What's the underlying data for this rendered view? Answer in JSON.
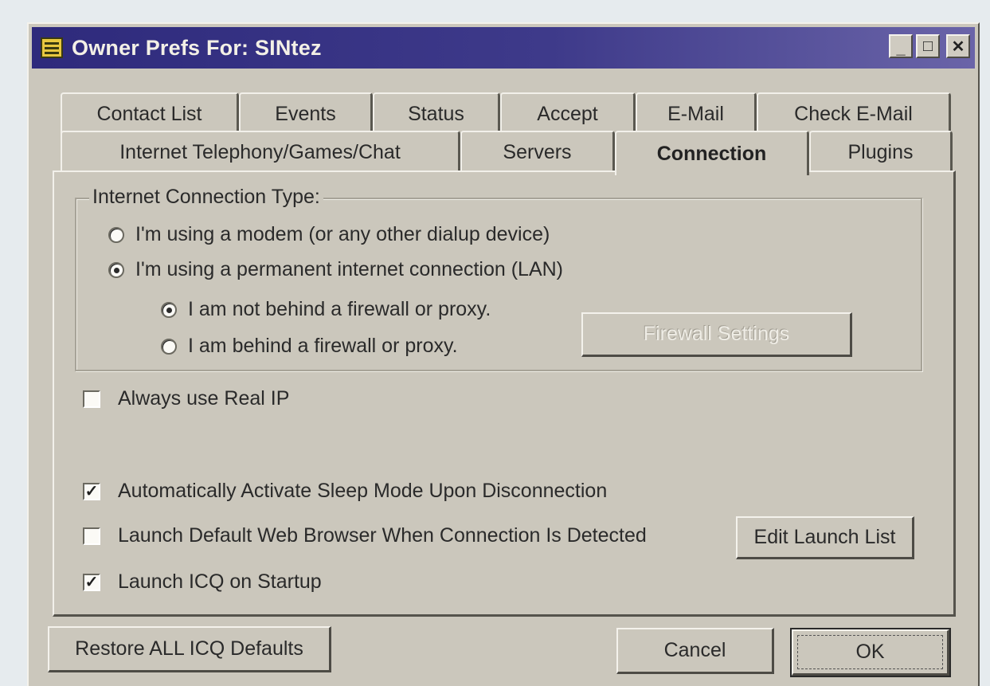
{
  "window": {
    "title": "Owner Prefs For: SINtez",
    "minimize_glyph": "_",
    "maximize_glyph": "□",
    "close_glyph": "✕"
  },
  "tabs_row1": [
    "Contact List",
    "Events",
    "Status",
    "Accept",
    "E-Mail",
    "Check E-Mail"
  ],
  "tabs_row2": [
    "Internet Telephony/Games/Chat",
    "Servers",
    "Connection",
    "Plugins"
  ],
  "active_tab": "Connection",
  "connection": {
    "group_label": "Internet Connection Type:",
    "radio_modem": "I'm using a modem (or any other dialup device)",
    "radio_lan": "I'm using a permanent internet connection (LAN)",
    "radio_no_firewall": "I am not behind a firewall or proxy.",
    "radio_firewall": "I am behind a firewall or proxy.",
    "firewall_settings_button": "Firewall Settings",
    "selected_type": "lan",
    "selected_firewall": "not_behind"
  },
  "options": {
    "real_ip": {
      "label": "Always use Real IP",
      "checked": false
    },
    "sleep_mode": {
      "label": "Automatically Activate Sleep Mode Upon Disconnection",
      "checked": true
    },
    "launch_browser": {
      "label": "Launch Default Web Browser When Connection Is Detected",
      "checked": false
    },
    "launch_icq": {
      "label": "Launch ICQ on Startup",
      "checked": true
    }
  },
  "buttons": {
    "edit_launch_list": "Edit Launch List",
    "restore_defaults": "Restore ALL ICQ Defaults",
    "cancel": "Cancel",
    "ok": "OK"
  }
}
